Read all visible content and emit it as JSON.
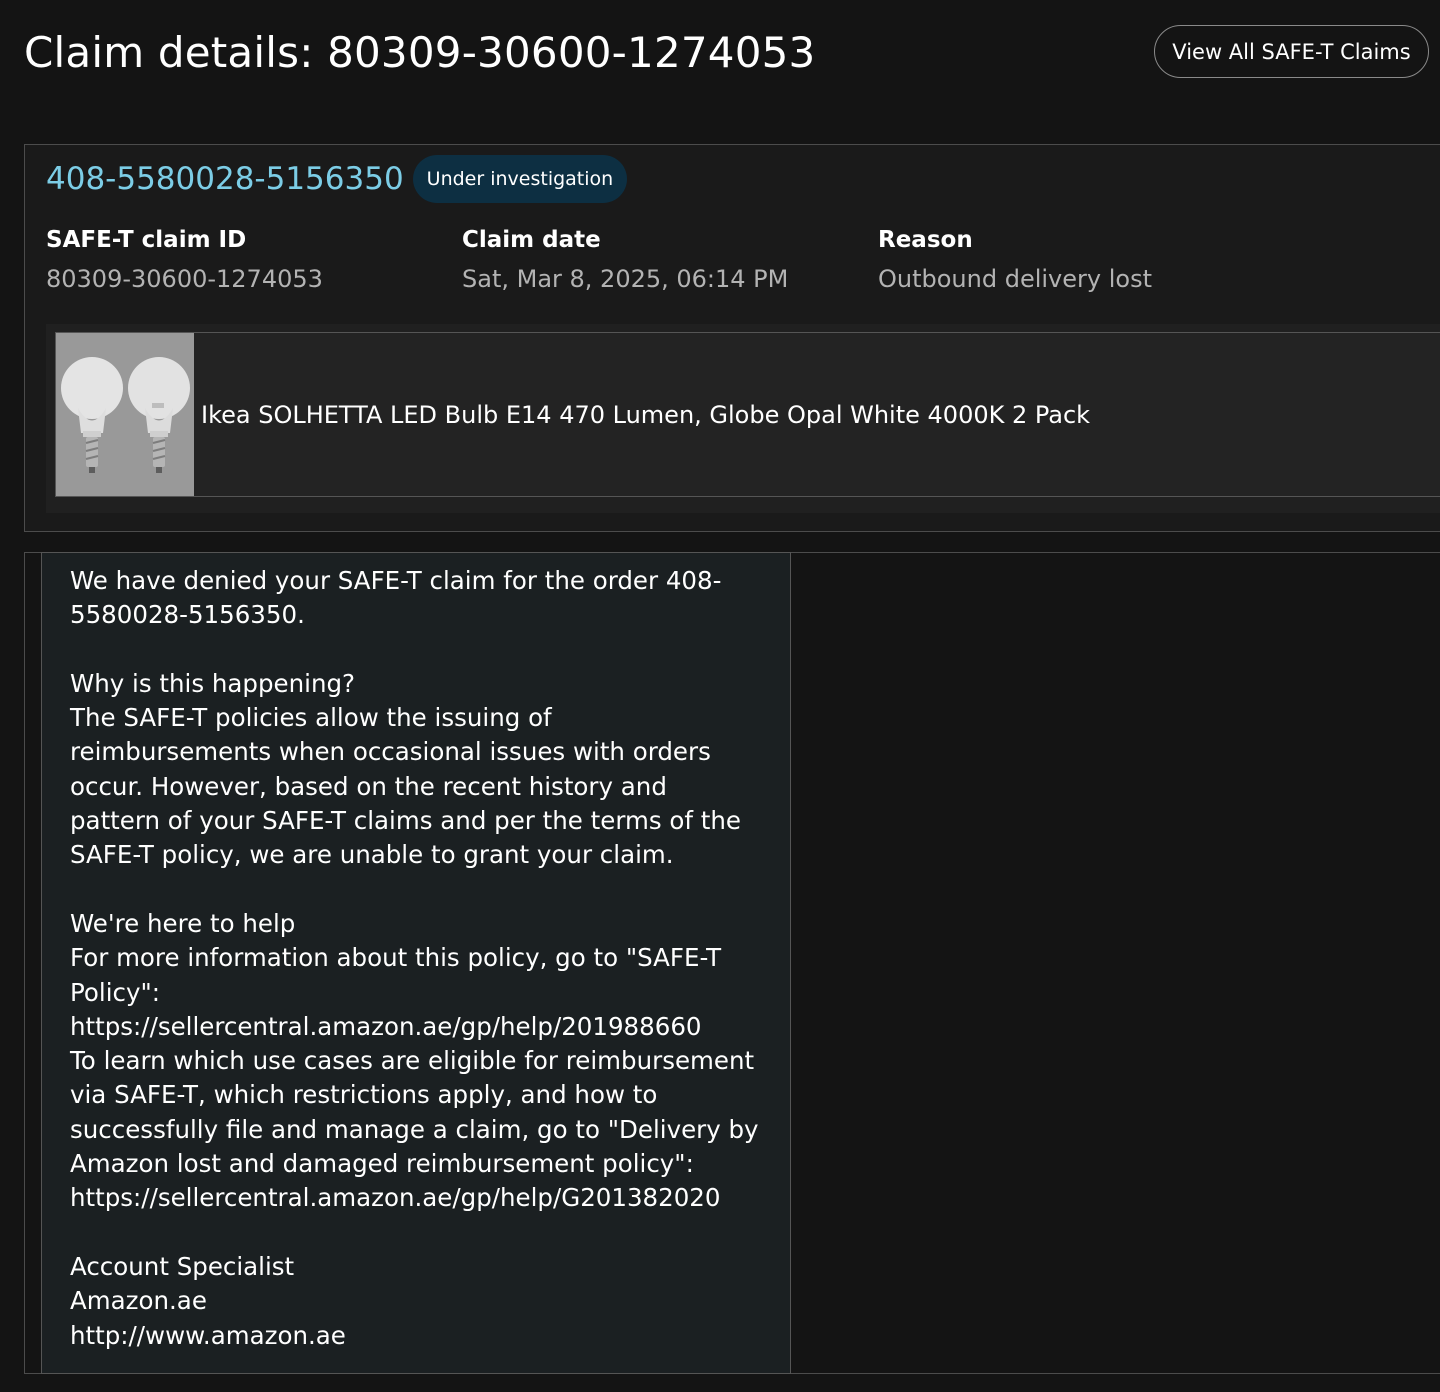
{
  "header": {
    "title": "Claim details: 80309-30600-1274053",
    "view_all_label": "View All SAFE-T Claims"
  },
  "claim": {
    "order_id": "408-5580028-5156350",
    "status": "Under investigation",
    "fields": [
      {
        "label": "SAFE-T claim ID",
        "value": "80309-30600-1274053"
      },
      {
        "label": "Claim date",
        "value": "Sat, Mar 8, 2025, 06:14 PM"
      },
      {
        "label": "Reason",
        "value": "Outbound delivery lost"
      }
    ],
    "product": {
      "title": "Ikea SOLHETTA LED Bulb E14 470 Lumen, Globe Opal White 4000K 2 Pack",
      "image_icon": "led-bulb-pair-image"
    }
  },
  "message": {
    "lines": [
      "We have denied your SAFE-T claim for the order 408-",
      "5580028-5156350.",
      "",
      "Why is this happening?",
      "The SAFE-T policies allow the issuing of",
      "reimbursements when occasional issues with orders",
      "occur. However, based on the recent history and",
      "pattern of your SAFE-T claims and per the terms of the",
      "SAFE-T policy, we are unable to grant your claim.",
      "",
      "We're here to help",
      "For more information about this policy, go to \"SAFE-T",
      "Policy\":",
      "https://sellercentral.amazon.ae/gp/help/201988660",
      "To learn which use cases are eligible for reimbursement",
      "via SAFE-T, which restrictions apply, and how to",
      "successfully file and manage a claim, go to \"Delivery by",
      "Amazon lost and damaged reimbursement policy\":",
      "https://sellercentral.amazon.ae/gp/help/G201382020",
      "",
      "Account Specialist",
      "Amazon.ae",
      "http://www.amazon.ae"
    ]
  },
  "colors": {
    "background": "#141414",
    "link": "#7ccde6",
    "badge": "#0d2f42",
    "muted_text": "#b3b3b3",
    "message_bg": "#1b2022"
  }
}
